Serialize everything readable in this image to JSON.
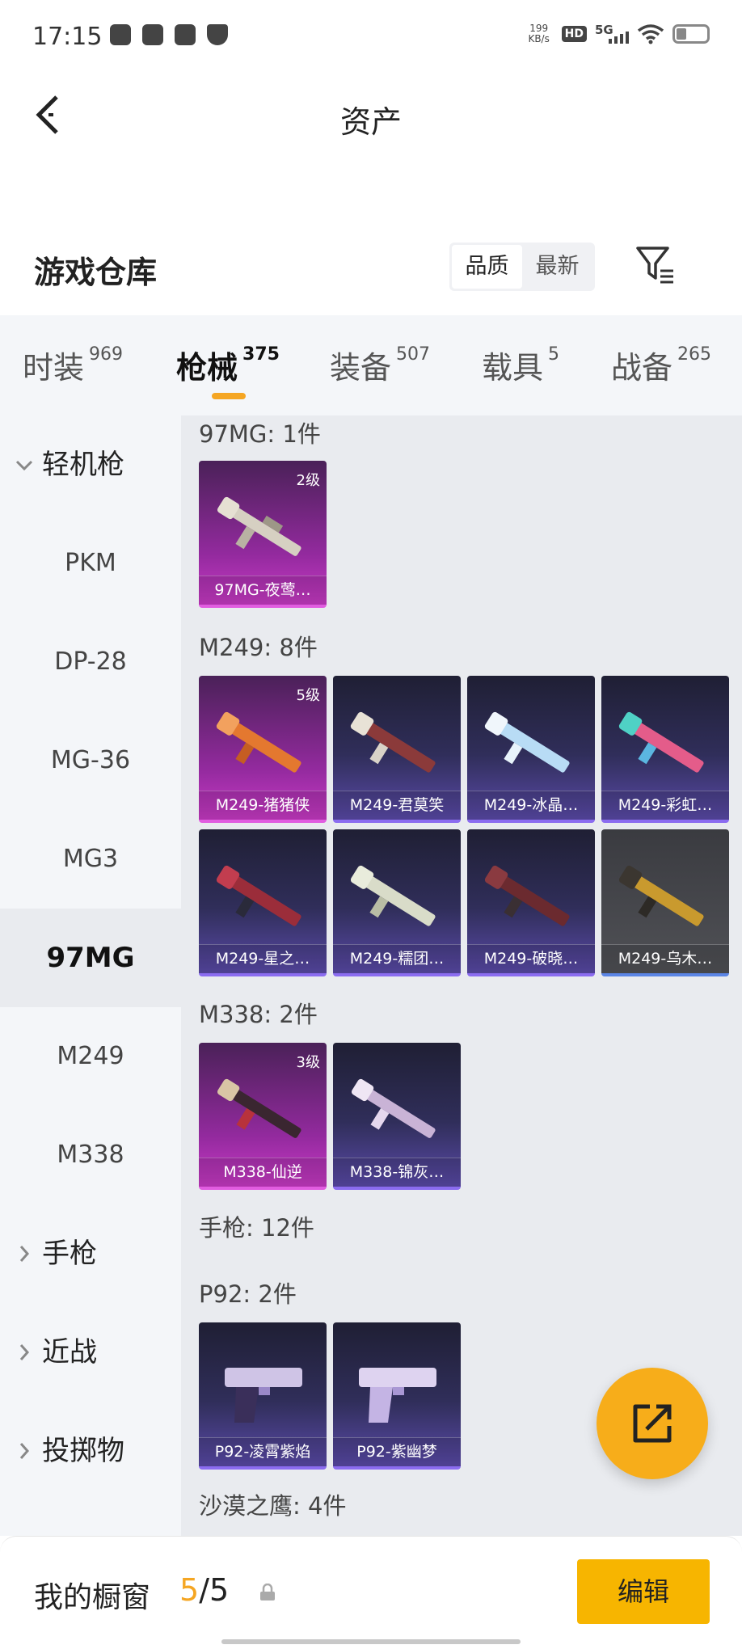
{
  "status_bar": {
    "time": "17:15",
    "speed": "199",
    "speed_unit": "KB/s",
    "hd": "HD",
    "network": "5G"
  },
  "header": {
    "title": "资产"
  },
  "warehouse": {
    "title": "游戏仓库",
    "sort_options": [
      "品质",
      "最新"
    ],
    "active_sort": "品质"
  },
  "tabs": [
    {
      "label": "时装",
      "count": "969"
    },
    {
      "label": "枪械",
      "count": "375"
    },
    {
      "label": "装备",
      "count": "507"
    },
    {
      "label": "载具",
      "count": "5"
    },
    {
      "label": "战备",
      "count": "265"
    }
  ],
  "sidebar": {
    "group_lmg": "轻机枪",
    "items": [
      "PKM",
      "DP-28",
      "MG-36",
      "MG3",
      "97MG",
      "M249",
      "M338"
    ],
    "active_item": "97MG",
    "group_pistol": "手枪",
    "group_melee": "近战",
    "group_throw": "投掷物"
  },
  "sections": [
    {
      "title": "97MG: 1件",
      "items": [
        {
          "name": "97MG-夜莺…",
          "level": "2级",
          "rarity": "purple"
        }
      ]
    },
    {
      "title": "M249: 8件",
      "items": [
        {
          "name": "M249-猪猪侠",
          "level": "5级",
          "rarity": "purple"
        },
        {
          "name": "M249-君莫笑",
          "level": "",
          "rarity": "blue"
        },
        {
          "name": "M249-冰晶…",
          "level": "",
          "rarity": "blue"
        },
        {
          "name": "M249-彩虹…",
          "level": "",
          "rarity": "blue"
        },
        {
          "name": "M249-星之…",
          "level": "",
          "rarity": "blue"
        },
        {
          "name": "M249-糯团…",
          "level": "",
          "rarity": "blue"
        },
        {
          "name": "M249-破晓…",
          "level": "",
          "rarity": "blue"
        },
        {
          "name": "M249-乌木…",
          "level": "",
          "rarity": "gray"
        }
      ]
    },
    {
      "title": "M338: 2件",
      "items": [
        {
          "name": "M338-仙逆",
          "level": "3级",
          "rarity": "purple"
        },
        {
          "name": "M338-锦灰…",
          "level": "",
          "rarity": "blue"
        }
      ]
    },
    {
      "title": "手枪: 12件",
      "items": []
    },
    {
      "title": "P92: 2件",
      "items": [
        {
          "name": "P92-凌霄紫焰",
          "level": "",
          "rarity": "blue"
        },
        {
          "name": "P92-紫幽梦",
          "level": "",
          "rarity": "blue"
        }
      ]
    },
    {
      "title": "沙漠之鹰: 4件",
      "items": []
    }
  ],
  "bottom_bar": {
    "label": "我的橱窗",
    "current": "5",
    "separator": "/",
    "total": "5",
    "edit_label": "编辑"
  },
  "colors": {
    "accent": "#f7b500",
    "tab_indicator": "#f5a623",
    "purple_card": "#932a9e",
    "blue_card": "#302e5a"
  }
}
